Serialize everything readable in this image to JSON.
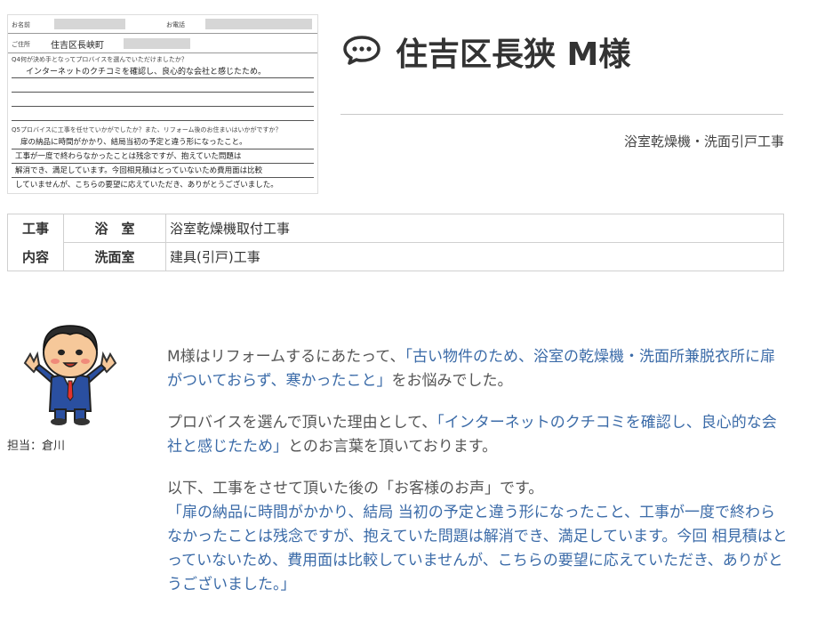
{
  "header": {
    "title": "住吉区長狭 M様",
    "subtitle": "浴室乾燥機・洗面引戸工事"
  },
  "survey_image": {
    "name_label": "お名前",
    "phone_label": "お電話",
    "address_label": "ご住所",
    "address_value": "住吉区長峡町",
    "q4_label": "Q4何が決め手となってプロバイスを選んでいただけましたか？",
    "q4_answer": "インターネットのクチコミを確認し、良心的な会社と感じたため。",
    "q5_label": "Q5プロバイスに工事を任せていかがでしたか？また、リフォーム後のお住まいはいかがですか？",
    "q5_line1": "扉の納品に時間がかかり、結局当初の予定と違う形になったこと。",
    "q5_line2": "工事が一度で終わらなかったことは残念ですが、抱えていた問題は",
    "q5_line3": "解消でき、満足しています。今回相見積はとっていないため費用面は比較",
    "q5_line4": "していませんが、こちらの要望に応えていただき、ありがとうございました。"
  },
  "work_table": {
    "group_label_1": "工事",
    "group_label_2": "内容",
    "rows": [
      {
        "place": "浴　室",
        "task": "浴室乾燥機取付工事"
      },
      {
        "place": "洗面室",
        "task": "建具(引戸)工事"
      }
    ]
  },
  "staff": {
    "label": "担当：倉川"
  },
  "paragraphs": {
    "p1_a": "M様はリフォームするにあたって、",
    "p1_b": "「古い物件のため、浴室の乾燥機・洗面所兼脱衣所に扉がついておらず、寒かったこと」",
    "p1_c": "をお悩みでした。",
    "p2_a": "プロバイスを選んで頂いた理由として、",
    "p2_b": "「インターネットのクチコミを確認し、良心的な会社と感じたため」",
    "p2_c": "とのお言葉を頂いております。",
    "p3_a": "以下、工事をさせて頂いた後の「お客様のお声」です。",
    "p3_b": "「扉の納品に時間がかかり、結局 当初の予定と違う形になったこと、工事が一度で終わらなかったことは残念ですが、抱えていた問題は解消でき、満足しています。今回 相見積はとっていないため、費用面は比較していませんが、こちらの要望に応えていただき、ありがとうございました。」"
  },
  "colors": {
    "accent_blue": "#3b6ba8",
    "text_gray": "#555555"
  },
  "icons": {
    "title_icon": "speech-bubble-icon",
    "avatar": "staff-mascot-avatar"
  }
}
